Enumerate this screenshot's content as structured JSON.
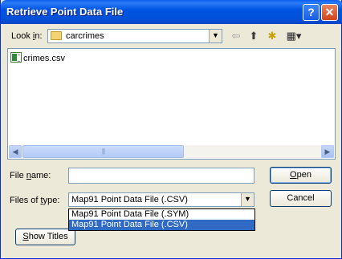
{
  "window": {
    "title": "Retrieve Point Data File",
    "help_glyph": "?",
    "close_glyph": "✕"
  },
  "lookin": {
    "label_pre": "Look ",
    "label_ul": "i",
    "label_post": "n:",
    "value": "carcrimes",
    "arrow": "▼"
  },
  "toolbar": {
    "back_icon": "⇦",
    "up_icon": "⬆",
    "newfolder_icon": "✱",
    "views_icon": "▦▾"
  },
  "files": [
    {
      "name": "crimes.csv",
      "icon": "csv-file-icon"
    }
  ],
  "scroll": {
    "left": "◀",
    "right": "▶",
    "grip": "|||"
  },
  "filename": {
    "label_pre": "File ",
    "label_ul": "n",
    "label_post": "ame:",
    "value": ""
  },
  "filetype": {
    "label_pre": "Files of ",
    "label_ul": "t",
    "label_post": "ype:",
    "value": "Map91 Point Data File (.CSV)",
    "arrow": "▼",
    "options": [
      {
        "label": "Map91 Point Data File (.SYM)",
        "selected": false
      },
      {
        "label": "Map91 Point Data File (.CSV)",
        "selected": true
      }
    ]
  },
  "buttons": {
    "open_ul": "O",
    "open_rest": "pen",
    "cancel": "Cancel",
    "show_titles_ul": "S",
    "show_titles_rest": "how Titles"
  },
  "colors": {
    "titlebar": "#0054e3",
    "selection": "#316ac5",
    "dialog_bg": "#ece9d8"
  }
}
